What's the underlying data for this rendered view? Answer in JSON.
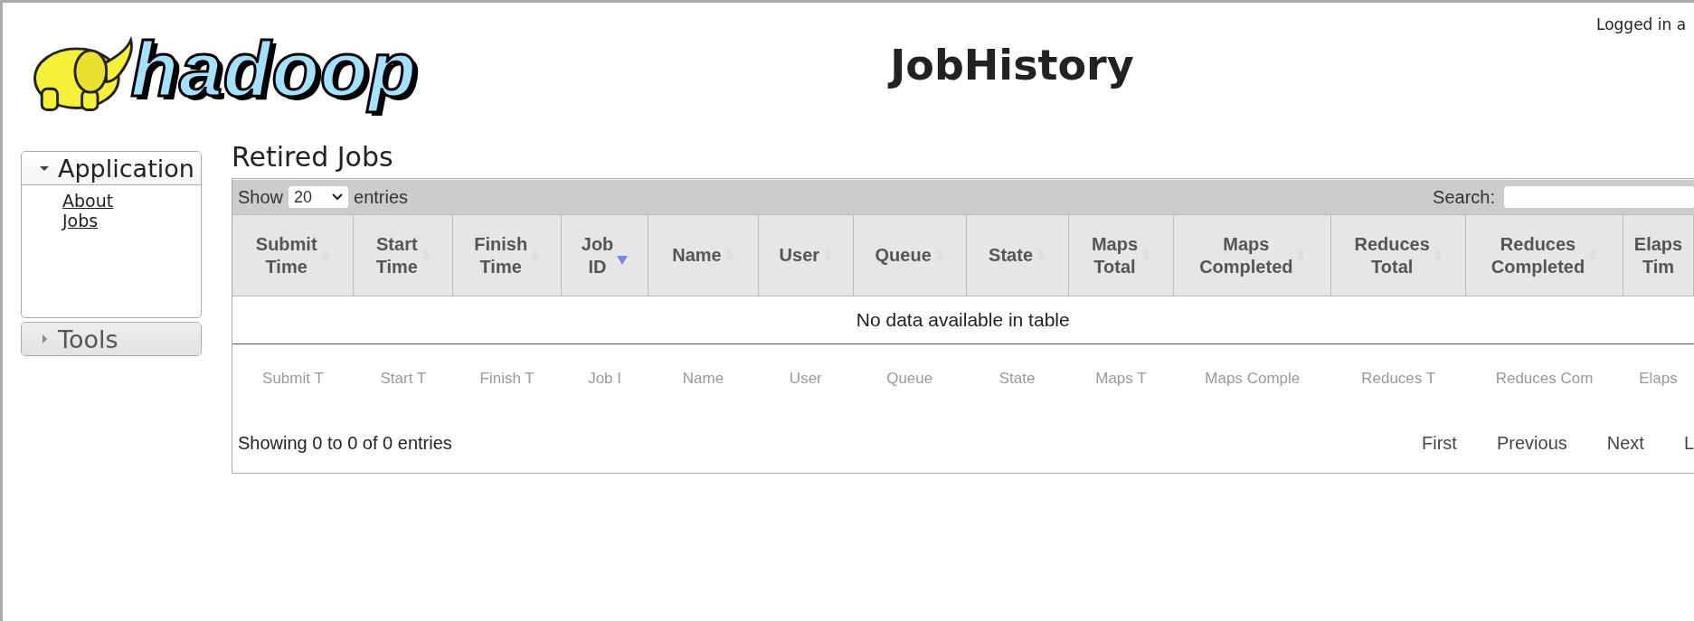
{
  "header": {
    "logo_text": "hadoop",
    "title": "JobHistory",
    "login": "Logged in a"
  },
  "sidebar": {
    "sections": [
      {
        "label": "Application",
        "expanded": true,
        "links": [
          "About",
          "Jobs"
        ]
      },
      {
        "label": "Tools",
        "expanded": false
      }
    ]
  },
  "main": {
    "title": "Retired Jobs",
    "length_menu": {
      "before": "Show",
      "value": "20",
      "after": "entries"
    },
    "search": {
      "label": "Search:"
    },
    "columns": [
      {
        "lines": [
          "Submit",
          "Time"
        ],
        "sorted_descending": false
      },
      {
        "lines": [
          "Start",
          "Time"
        ],
        "sorted_descending": false
      },
      {
        "lines": [
          "Finish",
          "Time"
        ],
        "sorted_descending": false
      },
      {
        "lines": [
          "Job",
          "ID"
        ],
        "sorted_descending": true
      },
      {
        "lines": [
          "Name"
        ],
        "sorted_descending": false
      },
      {
        "lines": [
          "User"
        ],
        "sorted_descending": false
      },
      {
        "lines": [
          "Queue"
        ],
        "sorted_descending": false
      },
      {
        "lines": [
          "State"
        ],
        "sorted_descending": false
      },
      {
        "lines": [
          "Maps",
          "Total"
        ],
        "sorted_descending": false
      },
      {
        "lines": [
          "Maps",
          "Completed"
        ],
        "sorted_descending": false
      },
      {
        "lines": [
          "Reduces",
          "Total"
        ],
        "sorted_descending": false
      },
      {
        "lines": [
          "Reduces",
          "Completed"
        ],
        "sorted_descending": false
      },
      {
        "lines": [
          "Elaps",
          "Tim"
        ]
      }
    ],
    "empty_message": "No data available in table",
    "filters": [
      {
        "placeholder": "Submit T"
      },
      {
        "placeholder": "Start T"
      },
      {
        "placeholder": "Finish T"
      },
      {
        "placeholder": "Job I"
      },
      {
        "placeholder": "Name"
      },
      {
        "placeholder": "User"
      },
      {
        "placeholder": "Queue"
      },
      {
        "placeholder": "State"
      },
      {
        "placeholder": "Maps T"
      },
      {
        "placeholder": "Maps Comple"
      },
      {
        "placeholder": "Reduces T"
      },
      {
        "placeholder": "Reduces Com"
      },
      {
        "placeholder": "Elaps"
      }
    ],
    "info": "Showing 0 to 0 of 0 entries",
    "pagination": [
      "First",
      "Previous",
      "Next",
      "L"
    ]
  }
}
